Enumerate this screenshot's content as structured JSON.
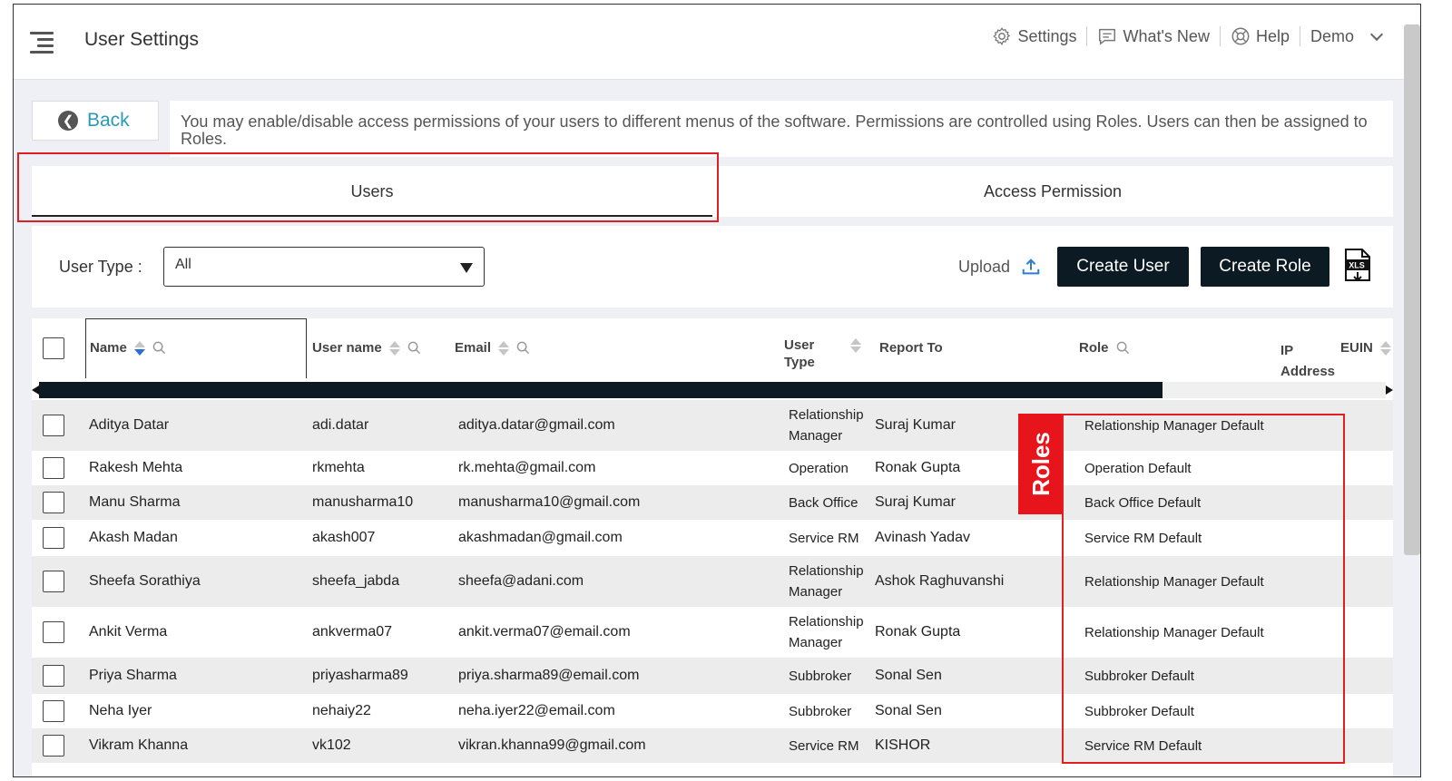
{
  "header": {
    "title": "User Settings",
    "nav": [
      {
        "label": "Settings",
        "icon": "gear-icon"
      },
      {
        "label": "What's New",
        "icon": "message-icon"
      },
      {
        "label": "Help",
        "icon": "help-icon"
      }
    ],
    "account": "Demo"
  },
  "back_label": "Back",
  "info_text": "You may enable/disable access permissions of your users to different menus of the software. Permissions are controlled using Roles. Users can then be assigned to Roles.",
  "tabs": [
    "Users",
    "Access Permission"
  ],
  "active_tab": "Users",
  "toolbar": {
    "user_type_label": "User Type :",
    "user_type_value": "All",
    "upload_label": "Upload",
    "create_user_label": "Create User",
    "create_role_label": "Create Role",
    "export_icon_text": "XLS"
  },
  "table": {
    "columns": [
      "Name",
      "User name",
      "Email",
      "User Type",
      "Report To",
      "Role",
      "IP Address",
      "EUIN"
    ],
    "rows": [
      {
        "name": "Aditya Datar",
        "username": "adi.datar",
        "email": "aditya.datar@gmail.com",
        "user_type": "Relationship Manager",
        "report_to": "Suraj Kumar",
        "role": "Relationship Manager Default"
      },
      {
        "name": "Rakesh Mehta",
        "username": "rkmehta",
        "email": "rk.mehta@gmail.com",
        "user_type": "Operation",
        "report_to": "Ronak Gupta",
        "role": "Operation Default"
      },
      {
        "name": "Manu Sharma",
        "username": "manusharma10",
        "email": "manusharma10@gmail.com",
        "user_type": "Back Office",
        "report_to": "Suraj Kumar",
        "role": "Back Office Default"
      },
      {
        "name": "Akash Madan",
        "username": "akash007",
        "email": "akashmadan@gmail.com",
        "user_type": "Service RM",
        "report_to": "Avinash Yadav",
        "role": "Service RM Default"
      },
      {
        "name": "Sheefa Sorathiya",
        "username": "sheefa_jabda",
        "email": "sheefa@adani.com",
        "user_type": "Relationship Manager",
        "report_to": "Ashok Raghuvanshi",
        "role": "Relationship Manager Default"
      },
      {
        "name": "Ankit Verma",
        "username": "ankverma07",
        "email": "ankit.verma07@email.com",
        "user_type": "Relationship Manager",
        "report_to": "Ronak Gupta",
        "role": "Relationship Manager Default"
      },
      {
        "name": "Priya Sharma",
        "username": "priyasharma89",
        "email": "priya.sharma89@email.com",
        "user_type": "Subbroker",
        "report_to": "Sonal Sen",
        "role": "Subbroker Default"
      },
      {
        "name": "Neha Iyer",
        "username": "nehaiy22",
        "email": "neha.iyer22@email.com",
        "user_type": "Subbroker",
        "report_to": "Sonal Sen",
        "role": "Subbroker Default"
      },
      {
        "name": "Vikram Khanna",
        "username": "vk102",
        "email": "vikran.khanna99@gmail.com",
        "user_type": "Service RM",
        "report_to": "KISHOR",
        "role": "Service RM Default"
      }
    ]
  },
  "annotation": {
    "label": "Roles",
    "color": "#e8141c"
  }
}
